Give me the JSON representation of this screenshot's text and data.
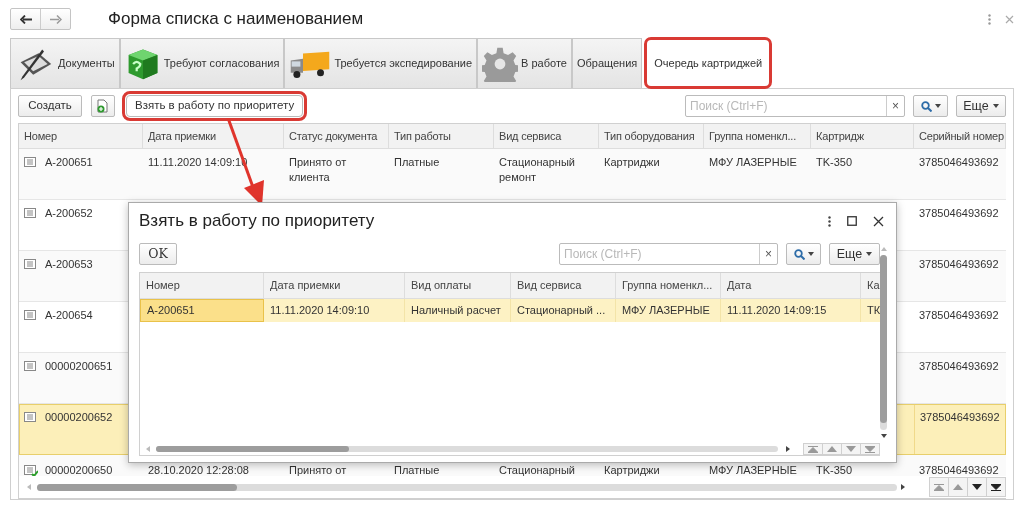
{
  "window": {
    "title": "Форма списка с наименованием"
  },
  "tabs": [
    {
      "label": "Документы",
      "selected": false,
      "highlighted": false
    },
    {
      "label": "Требуют согласования",
      "selected": false,
      "highlighted": false
    },
    {
      "label": "Требуется экспедирование",
      "selected": false,
      "highlighted": false
    },
    {
      "label": "В работе",
      "selected": false,
      "highlighted": false
    },
    {
      "label": "Обращения",
      "selected": false,
      "highlighted": false
    },
    {
      "label": "Очередь картриджей",
      "selected": true,
      "highlighted": true
    }
  ],
  "toolbar": {
    "create": "Создать",
    "take_by_priority": {
      "label": "Взять в работу по приоритету",
      "highlighted": true
    },
    "search": {
      "placeholder": "Поиск (Ctrl+F)"
    },
    "clear": "×",
    "more": "Еще"
  },
  "table": {
    "columns": [
      "Номер",
      "Дата приемки",
      "Статус документа",
      "Тип работы",
      "Вид сервиса",
      "Тип оборудования",
      "Группа номенкл...",
      "Картридж",
      "Серийный номер"
    ],
    "rows": [
      {
        "selected": false,
        "posted": false,
        "cells": {
          "0": "А-200651",
          "1": "11.11.2020 14:09:10",
          "2": "Принято от клиента",
          "3": "Платные",
          "4": "Стационарный ремонт",
          "5": "Картриджи",
          "6": "МФУ ЛАЗЕРНЫЕ",
          "7": "TK-350",
          "8": "3785046493692"
        }
      },
      {
        "selected": false,
        "posted": false,
        "cells": {
          "0": "А-200652",
          "8": "3785046493692"
        }
      },
      {
        "selected": false,
        "posted": false,
        "cells": {
          "0": "А-200653",
          "8": "3785046493692"
        }
      },
      {
        "selected": false,
        "posted": false,
        "cells": {
          "0": "А-200654",
          "8": "3785046493692"
        }
      },
      {
        "selected": false,
        "posted": false,
        "cells": {
          "0": "00000200651",
          "8": "3785046493692"
        }
      },
      {
        "selected": true,
        "posted": false,
        "cells": {
          "0": "00000200652",
          "8": "3785046493692"
        }
      },
      {
        "selected": false,
        "posted": true,
        "cells": {
          "0": "00000200650",
          "1": "28.10.2020 12:28:08",
          "2": "Принято от",
          "3": "Платные",
          "4": "Стационарный",
          "5": "Картриджи",
          "6": "МФУ ЛАЗЕРНЫЕ",
          "7": "TK-350",
          "8": "3785046493692"
        }
      }
    ]
  },
  "dialog": {
    "title": "Взять в работу по приоритету",
    "ok": "OK",
    "search": {
      "placeholder": "Поиск (Ctrl+F)"
    },
    "clear": "×",
    "more": "Еще",
    "table": {
      "columns": [
        "Номер",
        "Дата приемки",
        "Вид оплаты",
        "Вид сервиса",
        "Группа номенкл...",
        "Дата",
        "Ка"
      ],
      "rows": [
        {
          "selected": true,
          "cells": [
            "А-200651",
            "11.11.2020 14:09:10",
            "Наличный расчет",
            "Стационарный ...",
            "МФУ ЛАЗЕРНЫЕ",
            "11.11.2020 14:09:15",
            "ТК"
          ]
        }
      ]
    }
  }
}
